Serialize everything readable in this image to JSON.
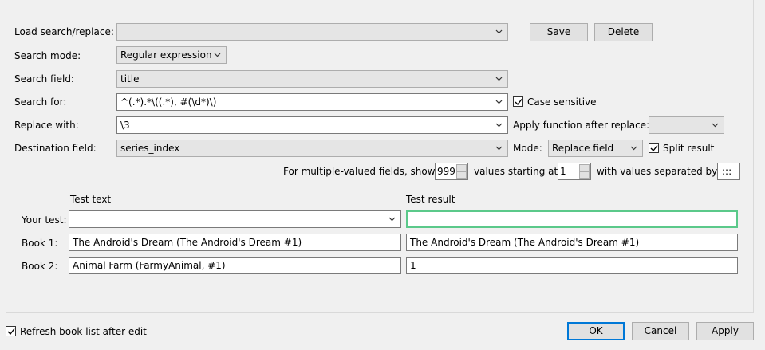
{
  "load": {
    "label": "Load search/replace:",
    "value": "",
    "save": "Save",
    "delete": "Delete"
  },
  "search_mode": {
    "label": "Search mode:",
    "value": "Regular expression"
  },
  "search_field": {
    "label": "Search field:",
    "value": "title"
  },
  "search_for": {
    "label": "Search for:",
    "value": "^(.*).*\\((.*), #(\\d*)\\)",
    "case_sensitive_label": "Case sensitive",
    "case_sensitive": true
  },
  "replace_with": {
    "label": "Replace with:",
    "value": "\\3",
    "apply_function_label": "Apply function after replace:",
    "apply_function_value": ""
  },
  "destination": {
    "label": "Destination field:",
    "value": "series_index",
    "mode_label": "Mode:",
    "mode_value": "Replace field",
    "split_label": "Split result",
    "split": true
  },
  "multi": {
    "prefix": "For multiple-valued fields, show",
    "show_count": "999",
    "middle": "values starting at",
    "start": "1",
    "suffix": "with values separated by",
    "separator": ":::"
  },
  "test": {
    "text_header": "Test text",
    "result_header": "Test result",
    "rows": [
      {
        "label": "Your test:",
        "text": "",
        "result": ""
      },
      {
        "label": "Book 1:",
        "text": "The Android's Dream (The Android's Dream #1)",
        "result": "The Android's Dream (The Android's Dream #1)"
      },
      {
        "label": "Book 2:",
        "text": "Animal Farm (FarmyAnimal, #1)",
        "result": "1"
      }
    ]
  },
  "footer": {
    "refresh_label": "Refresh book list after edit",
    "refresh": true,
    "ok": "OK",
    "cancel": "Cancel",
    "apply": "Apply"
  },
  "colors": {
    "focus_border": "#5bc98a",
    "default_button": "#0078d7"
  },
  "icons": {
    "dropdown": "chevron-down-icon",
    "check": "checkmark-icon",
    "spin_up": "triangle-up-icon",
    "spin_down": "triangle-down-icon"
  }
}
